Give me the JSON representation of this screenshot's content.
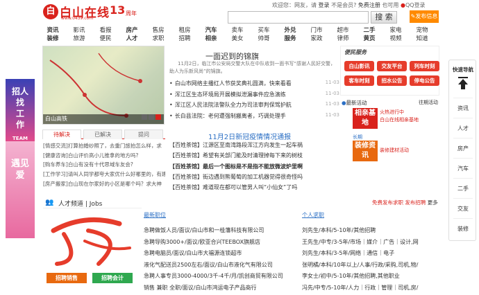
{
  "header": {
    "logo_mark": "白",
    "logo_text": "白山在线",
    "logo_url": "www.0439.com",
    "anniv_num": "13",
    "anniv_unit": "周年",
    "welcome": "欢迎您：网友，请",
    "login": "登录",
    "not_member": "不是会员?",
    "register": "免费注册",
    "forgot": "也可用",
    "qq_login": "QQ登录",
    "search_placeholder": "",
    "search_button": "搜 索",
    "post_button": "发布信息"
  },
  "nav": [
    {
      "top": "资讯",
      "bottom": "装修",
      "bold": true
    },
    {
      "top": "影讯",
      "bottom": "旅游",
      "bold": false
    },
    {
      "top": "看报",
      "bottom": "便民",
      "bold": false
    },
    {
      "top": "房产",
      "bottom": "人才",
      "bold": true
    },
    {
      "top": "售房",
      "bottom": "求职",
      "bold": false
    },
    {
      "top": "租房",
      "bottom": "招聘",
      "bold": false
    },
    {
      "top": "汽车",
      "bottom": "相亲",
      "bold": true
    },
    {
      "top": "卖车",
      "bottom": "美女",
      "bold": false
    },
    {
      "top": "买车",
      "bottom": "帅哥",
      "bold": false
    },
    {
      "top": "外兑",
      "bottom": "服务",
      "bold": true
    },
    {
      "top": "门市",
      "bottom": "家政",
      "bold": false
    },
    {
      "top": "超市",
      "bottom": "律师",
      "bold": false
    },
    {
      "top": "二手",
      "bottom": "黄页",
      "bold": true
    },
    {
      "top": "家电",
      "bottom": "视频",
      "bold": false
    },
    {
      "top": "宠物",
      "bottom": "知道",
      "bold": false
    }
  ],
  "left_ad": {
    "ad1_line1": "招人",
    "ad1_line2": "找工作",
    "ad1_tag": "TEAM",
    "ad2_line1": "遇见",
    "ad2_line2": "爱"
  },
  "map": {
    "caption": "白山高铁"
  },
  "headline": {
    "title": "一面迟到的锦旗",
    "summary": "11月2日，临江市公安局交警大队在中队收到一面书写“感谢人民好交警，助人为乐新风尚”的锦旗。"
  },
  "news1": [
    {
      "title": "白山市网络主播红人节获奖典礼圆满，快来看看",
      "date": "11-03"
    },
    {
      "title": "浑江区生态环境局开展模拟泄漏事件应急演练",
      "date": "11-03"
    },
    {
      "title": "浑江区人民法院法警队全力为司法审判保驾护航",
      "date": "11-03"
    },
    {
      "title": "长白县法院：老何遭强制搬离者，巧调处理手",
      "date": "11-03"
    }
  ],
  "sub_headline": "11月2日新冠疫情情况通报",
  "news2": [
    {
      "tag": "【百姓茶馆】",
      "title": "江源区至南湾路段浑江方向发生一起车祸",
      "bold": false
    },
    {
      "tag": "【百姓茶馆】",
      "title": "希望有关部门能及时清理掉每下来的树枝",
      "bold": false
    },
    {
      "tag": "【百姓茶馆】",
      "title": "最后一个图标是不是指不能放微波炉里啊",
      "bold": true
    },
    {
      "tag": "【百姓茶馆】",
      "title": "街边遇到熊葡萄的加工机器觉得很奇怪吗",
      "bold": false
    },
    {
      "tag": "【百姓茶馆】",
      "title": "难道现在都可以管男人叫“小仙女”了吗",
      "bold": false
    }
  ],
  "tabs": [
    {
      "label": "待解决",
      "active": true
    },
    {
      "label": "已解决",
      "active": false
    },
    {
      "label": "提问",
      "active": false
    }
  ],
  "tab_items": [
    "[情感交流]打算拍婚纱照了，去重门旅拍怎么样，求",
    "[健康咨询]白山评价高小儿推拿的地方吗?",
    "[购车养车]白山有没有十代思域车友会?",
    "[工作学习]请叫人同学都夸大家优什么好哪里的，有建议",
    "[房产搬家]白山现在尔家好的小区是哪个吗？求大神"
  ],
  "services": {
    "title": "便民服务",
    "buttons": [
      "白山影讯",
      "交友平台",
      "列车时刻",
      "客车时刻",
      "招水公告",
      "停电公告"
    ]
  },
  "activity": {
    "title": "最新活动",
    "more": "往期活动",
    "a1_label": "相亲基地",
    "a1_status": "火热进行中",
    "a1_desc": "白山在线相亲基地",
    "a2_label": "装修资讯",
    "a2_status": "长期",
    "a2_desc": "装修建材活动"
  },
  "talent": {
    "title": "人才频道",
    "sub": "Jobs",
    "btn1": "招聘销售",
    "btn2": "招聘会计",
    "free_post": "免费发布求职",
    "free_post2": "发布招聘",
    "more": "更多"
  },
  "jobs_title": "最新职位",
  "resume_title": "个人求职",
  "jobs": [
    "急聘做饭人员/面议/白山市和一桂藩科技有限公司",
    "急聘导购3000+/面议/欧亚合兴TEEBOX旗舰店",
    "急聘电脑员/面议/白山市大福源连锁超市",
    "液化气配送员2500左右/面议/白山市液化气有限公司",
    "急聘人事专员3000-4000/3千-4千/月/凯创商贸有限公司",
    "销售 兼职 全职/面议/白山市鸿运电子产品商行"
  ],
  "resumes": [
    "刘先生/本科/5-10年/其他招聘",
    "王先生/中专/3-5年/市场｜媒介｜广告｜设计,网",
    "刘先生/本科/3-5年/网络｜通信｜电子",
    "张明橘/本科/10年以上/人事/行政/采购,司机,物/",
    "李女士/初中/5-10年/其他招聘,其他职业",
    "冯先/中专/5-10年/人力｜行政｜管理｜司机,房/"
  ],
  "quick_nav": {
    "title": "快速导航",
    "items": [
      "资讯",
      "人才",
      "房产",
      "汽车",
      "二手",
      "交友",
      "装修"
    ]
  }
}
